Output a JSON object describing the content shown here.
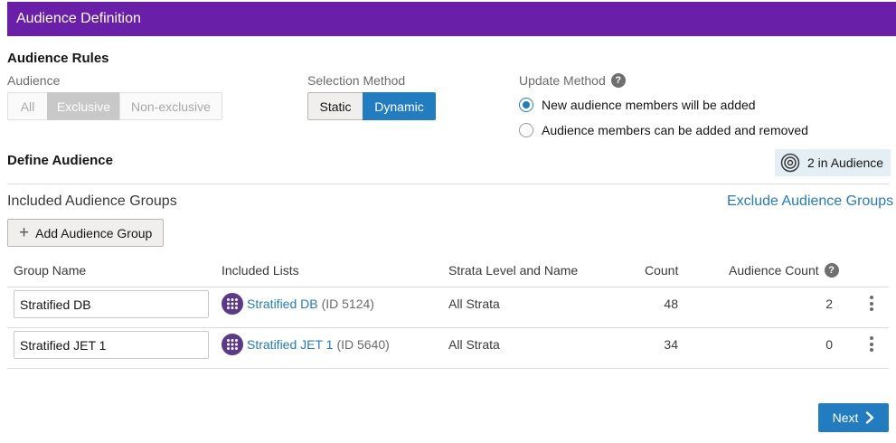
{
  "header": {
    "title": "Audience Definition"
  },
  "audience_rules": {
    "title": "Audience Rules",
    "audience": {
      "label": "Audience",
      "options": [
        "All",
        "Exclusive",
        "Non-exclusive"
      ],
      "selected": "Exclusive"
    },
    "selection_method": {
      "label": "Selection Method",
      "options": [
        "Static",
        "Dynamic"
      ],
      "selected": "Dynamic"
    },
    "update_method": {
      "label": "Update Method",
      "help": "?",
      "options": [
        "New audience members will be added",
        "Audience members can be added and removed"
      ],
      "selected": "New audience members will be added"
    }
  },
  "define_audience": {
    "title": "Define Audience",
    "badge": "2 in Audience",
    "included_title": "Included Audience Groups",
    "exclude_link": "Exclude Audience Groups",
    "add_button": "Add Audience Group",
    "add_icon": "+"
  },
  "table": {
    "headers": [
      "Group Name",
      "Included Lists",
      "Strata Level and Name",
      "Count",
      "Audience Count"
    ],
    "audience_count_help": "?",
    "rows": [
      {
        "group_name": "Stratified DB",
        "list_name": "Stratified DB",
        "list_id": "(ID 5124)",
        "strata": "All Strata",
        "count": "48",
        "audience_count": "2"
      },
      {
        "group_name": "Stratified JET 1",
        "list_name": "Stratified JET 1",
        "list_id": "(ID 5640)",
        "strata": "All Strata",
        "count": "34",
        "audience_count": "0"
      }
    ]
  },
  "footer": {
    "next_label": "Next"
  },
  "colors": {
    "header": "#6a1fa8",
    "accent": "#227cc0",
    "badge_bg": "#e4eef5",
    "list_icon": "#5b3a8c"
  }
}
